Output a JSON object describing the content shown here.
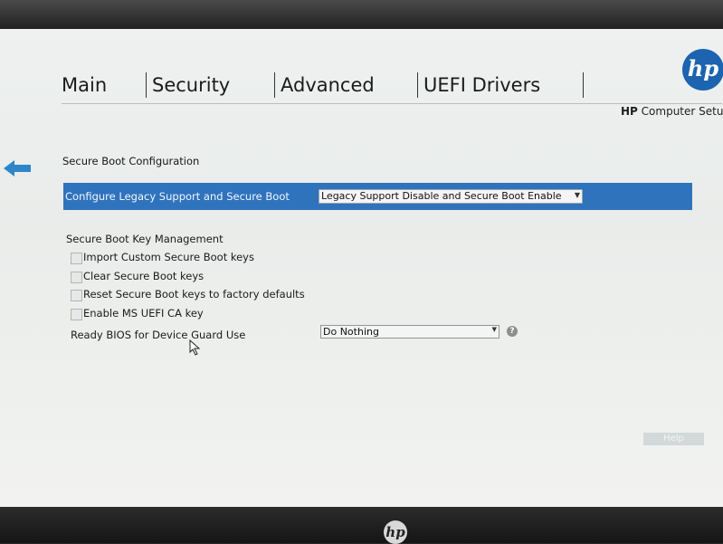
{
  "tabs": [
    {
      "label": "Main"
    },
    {
      "label": "Security"
    },
    {
      "label": "Advanced"
    },
    {
      "label": "UEFI Drivers"
    }
  ],
  "header": {
    "logo_text": "hp",
    "brand": "HP",
    "product": "Computer Setup"
  },
  "colors": {
    "accent": "#2f73bd",
    "hp_blue": "#1c63b0",
    "arrow_blue": "#2e86c8"
  },
  "page": {
    "section_title": "Secure Boot Configuration",
    "legacy_row": {
      "label": "Configure Legacy Support and Secure Boot",
      "value": "Legacy Support Disable and Secure Boot Enable"
    },
    "key_mgmt": {
      "title": "Secure Boot Key Management",
      "options": [
        {
          "label": "Import Custom Secure Boot keys",
          "checked": false
        },
        {
          "label": "Clear Secure Boot keys",
          "checked": false
        },
        {
          "label": "Reset Secure Boot keys to factory defaults",
          "checked": false
        },
        {
          "label": "Enable MS UEFI CA key",
          "checked": false
        }
      ]
    },
    "device_guard": {
      "label": "Ready BIOS for Device Guard Use",
      "value": "Do Nothing",
      "help_glyph": "?"
    },
    "help_button": "Help"
  },
  "bezel": {
    "logo_text": "hp"
  }
}
